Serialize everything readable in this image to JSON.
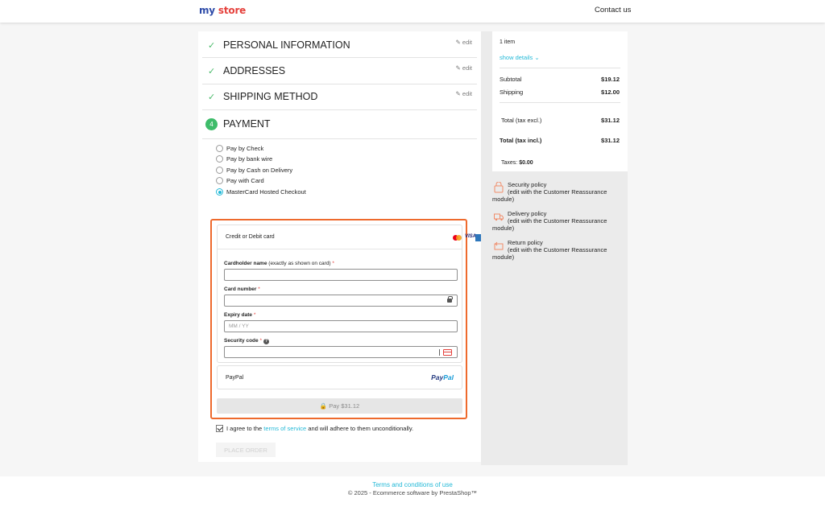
{
  "header": {
    "logo_part1": "my",
    "logo_part2": "store",
    "contact": "Contact us"
  },
  "steps": [
    {
      "title": "PERSONAL INFORMATION",
      "edit": "edit"
    },
    {
      "title": "ADDRESSES",
      "edit": "edit"
    },
    {
      "title": "SHIPPING METHOD",
      "edit": "edit"
    },
    {
      "title": "PAYMENT",
      "number": "4"
    }
  ],
  "payment_options": [
    {
      "label": "Pay by Check",
      "selected": false
    },
    {
      "label": "Pay by bank wire",
      "selected": false
    },
    {
      "label": "Pay by Cash on Delivery",
      "selected": false
    },
    {
      "label": "Pay with Card",
      "selected": false
    },
    {
      "label": "MasterCard Hosted Checkout",
      "selected": true
    }
  ],
  "card_form": {
    "header": "Credit or Debit card",
    "brands": {
      "visa": "VISA"
    },
    "cardholder_label": "Cardholder name",
    "cardholder_note": "(exactly as shown on card)",
    "card_number_label": "Card number",
    "expiry_label": "Expiry date",
    "expiry_placeholder": "MM  /  YY",
    "security_label": "Security code",
    "required_mark": "*",
    "help_mark": "?",
    "paypal_label": "PayPal",
    "paypal_logo_1": "Pay",
    "paypal_logo_2": "Pal",
    "pay_button": "🔒 Pay $31.12"
  },
  "terms": {
    "prefix": "I agree to the ",
    "link": "terms of service",
    "suffix": " and will adhere to them unconditionally.",
    "checked": true
  },
  "place_order": "PLACE ORDER",
  "summary": {
    "items": "1 item",
    "show_details": "show details",
    "subtotal_label": "Subtotal",
    "subtotal_value": "$19.12",
    "shipping_label": "Shipping",
    "shipping_value": "$12.00",
    "total_excl_label": "Total (tax excl.)",
    "total_excl_value": "$31.12",
    "total_incl_label": "Total (tax incl.)",
    "total_incl_value": "$31.12",
    "taxes_label": "Taxes:",
    "taxes_value": "$0.00"
  },
  "reassurance": [
    {
      "title": "Security policy",
      "sub": "(edit with the Customer Reassurance",
      "sub2": "module)",
      "icon": "shield-lock-icon"
    },
    {
      "title": "Delivery policy",
      "sub": "(edit with the Customer Reassurance",
      "sub2": "module)",
      "icon": "truck-icon"
    },
    {
      "title": "Return policy",
      "sub": "(edit with the Customer Reassurance",
      "sub2": "module)",
      "icon": "return-box-icon"
    }
  ],
  "footer": {
    "terms_link": "Terms and conditions of use",
    "copyright": "© 2025 - Ecommerce software by PrestaShop™"
  },
  "colors": {
    "accent": "#24b9d7",
    "check": "#4cbb6c",
    "highlight_border": "#ee6a2d",
    "reassurance_icon": "#f08c6a"
  }
}
